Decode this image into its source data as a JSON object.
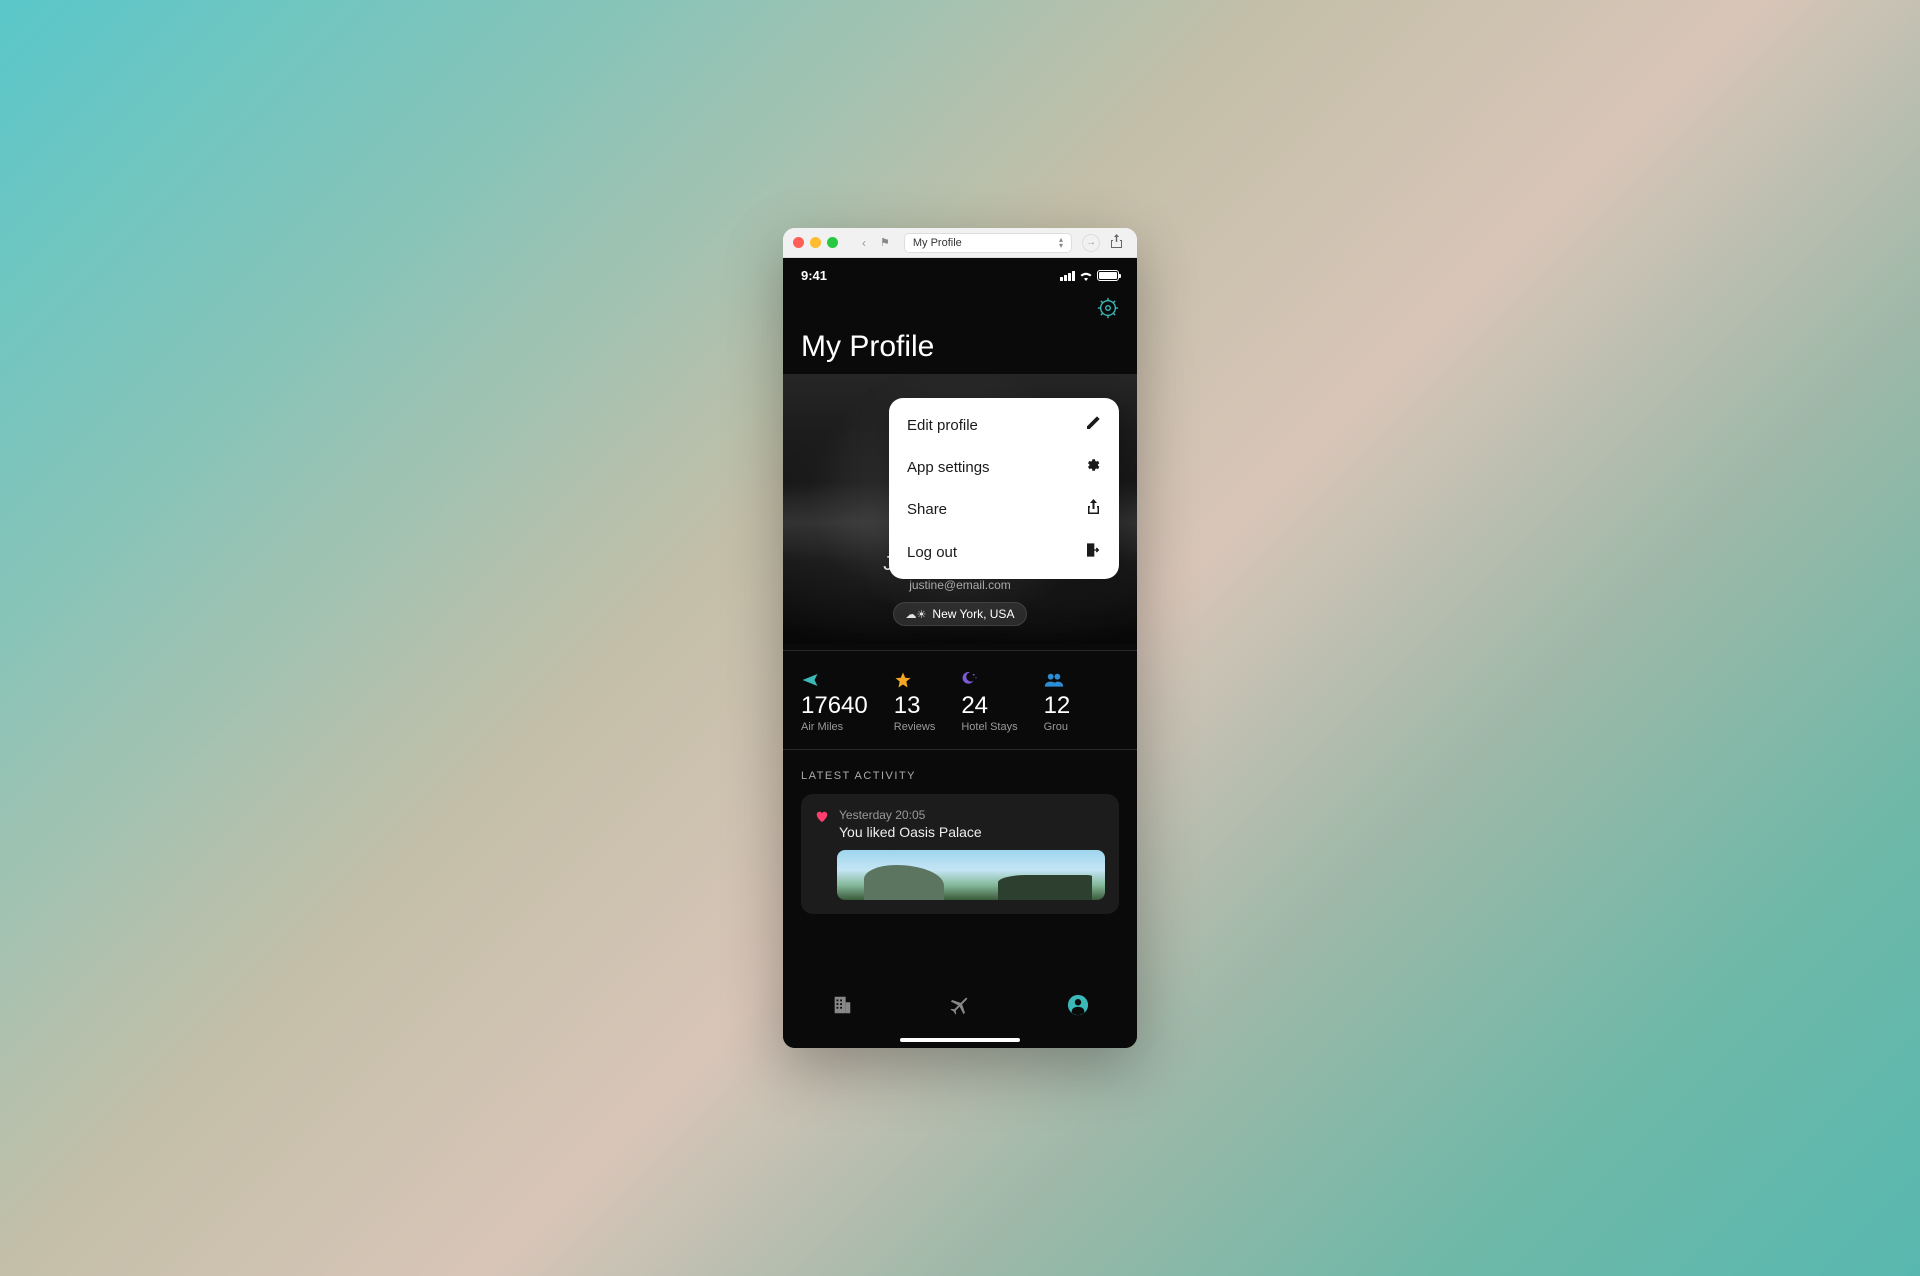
{
  "titlebar": {
    "select_label": "My Profile"
  },
  "status": {
    "time": "9:41"
  },
  "page": {
    "title": "My Profile"
  },
  "popover": {
    "edit": "Edit profile",
    "settings": "App settings",
    "share": "Share",
    "logout": "Log out"
  },
  "user": {
    "name": "Justine Robinson",
    "email": "justine@email.com",
    "location": "New York, USA"
  },
  "stats": [
    {
      "icon": "plane",
      "value": "17640",
      "label": "Air Miles"
    },
    {
      "icon": "star",
      "value": "13",
      "label": "Reviews"
    },
    {
      "icon": "moon",
      "value": "24",
      "label": "Hotel Stays"
    },
    {
      "icon": "group",
      "value": "12",
      "label": "Grou"
    }
  ],
  "activity": {
    "section_label": "LATEST ACTIVITY",
    "time": "Yesterday 20:05",
    "text": "You liked Oasis Palace"
  }
}
